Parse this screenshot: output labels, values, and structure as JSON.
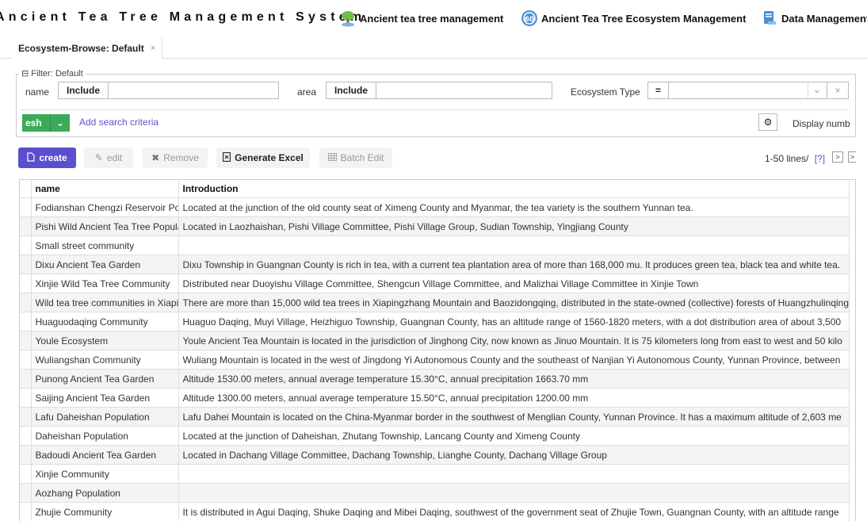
{
  "header": {
    "app_title": "Ancient Tea Tree Management System",
    "nav": [
      {
        "label": "Ancient tea tree management",
        "icon": "tea-tree-icon"
      },
      {
        "label": "Ancient Tea Tree Ecosystem Management",
        "icon": "ecosystem-icon"
      },
      {
        "label": "Data Management",
        "icon": "data-management-icon"
      }
    ]
  },
  "tabs": [
    {
      "label": "Ecosystem-Browse: Default",
      "close": "×"
    }
  ],
  "filter": {
    "legend": "⊟ Filter: Default",
    "name_label": "name",
    "name_operator": "Include",
    "name_value": "",
    "area_label": "area",
    "area_operator": "Include",
    "area_value": "",
    "ecosystem_type_label": "Ecosystem Type",
    "ecosystem_type_operator": "=",
    "ecosystem_type_value": "",
    "refresh_label": "esh",
    "dropdown_glyph": "⌄",
    "add_criteria_label": "Add search criteria",
    "gear_glyph": "⚙",
    "display_number_label": "Display numb",
    "clear_glyph": "×",
    "expand_glyph": "⌄"
  },
  "toolbar": {
    "create_label": "create",
    "edit_label": "edit",
    "remove_label": "Remove",
    "excel_label": "Generate Excel",
    "batch_edit_label": "Batch Edit"
  },
  "pager": {
    "text": "1-50 lines/",
    "help": "[?]",
    "next": ">",
    "last": ">"
  },
  "table": {
    "columns": [
      "name",
      "Introduction"
    ],
    "rows": [
      [
        "Fodianshan Chengzi Reservoir Population",
        "Located at the junction of the old county seat of Ximeng County and Myanmar, the tea variety is the southern Yunnan tea."
      ],
      [
        "Pishi Wild Ancient Tea Tree Population",
        "Located in Laozhaishan, Pishi Village Committee, Pishi Village Group, Sudian Township, Yingjiang County"
      ],
      [
        "Small street community",
        ""
      ],
      [
        "Dixu Ancient Tea Garden",
        "Dixu Township in Guangnan County is rich in tea, with a current tea plantation area of more than 168,000 mu. It produces green tea, black tea and white tea."
      ],
      [
        "Xinjie Wild Tea Tree Community",
        "Distributed near Duoyishu Village Committee, Shengcun Village Committee, and Malizhai Village Committee in Xinjie Town"
      ],
      [
        "Wild tea tree communities in Xiapingzhang",
        "There are more than 15,000 wild tea trees in Xiapingzhang Mountain and Baozidongqing, distributed in the state-owned (collective) forests of Huangzhulinqing"
      ],
      [
        "Huaguodaqing Community",
        "Huaguo Daqing, Muyi Village, Heizhiguo Township, Guangnan County, has an altitude range of 1560-1820 meters, with a dot distribution area of about 3,500"
      ],
      [
        "Youle Ecosystem",
        "Youle Ancient Tea Mountain is located in the jurisdiction of Jinghong City, now known as Jinuo Mountain. It is 75 kilometers long from east to west and 50 kilo"
      ],
      [
        "Wuliangshan Community",
        "Wuliang Mountain is located in the west of Jingdong Yi Autonomous County and the southeast of Nanjian Yi Autonomous County, Yunnan Province, between"
      ],
      [
        "Punong Ancient Tea Garden",
        "Altitude 1530.00 meters, annual average temperature 15.30°C, annual precipitation 1663.70 mm"
      ],
      [
        "Saijing Ancient Tea Garden",
        "Altitude 1300.00 meters, annual average temperature 15.50°C, annual precipitation 1200.00 mm"
      ],
      [
        "Lafu Daheishan Population",
        "Lafu Dahei Mountain is located on the China-Myanmar border in the southwest of Menglian County, Yunnan Province. It has a maximum altitude of 2,603 me"
      ],
      [
        "Daheishan Population",
        "Located at the junction of Daheishan, Zhutang Township, Lancang County and Ximeng County"
      ],
      [
        "Badoudi Ancient Tea Garden",
        "Located in Dachang Village Committee, Dachang Township, Lianghe County, Dachang Village Group"
      ],
      [
        "Xinjie Community",
        ""
      ],
      [
        "Aozhang Population",
        ""
      ],
      [
        "Zhujie Community",
        "It is distributed in Agui Daqing, Shuke Daqing and Mibei Daqing, southwest of the government seat of Zhujie Town, Guangnan County, with an altitude range"
      ]
    ]
  },
  "colors": {
    "primary": "#5a4fcf",
    "refresh_green": "#3daa5a",
    "link": "#5a55c8"
  }
}
